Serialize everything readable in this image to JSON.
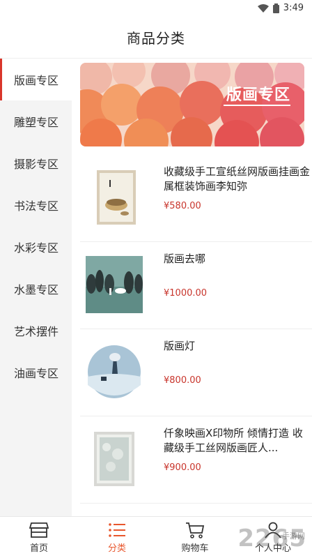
{
  "status_bar": {
    "time": "3:49"
  },
  "header": {
    "title": "商品分类"
  },
  "sidebar": {
    "items": [
      {
        "label": "版画专区"
      },
      {
        "label": "雕塑专区"
      },
      {
        "label": "摄影专区"
      },
      {
        "label": "书法专区"
      },
      {
        "label": "水彩专区"
      },
      {
        "label": "水墨专区"
      },
      {
        "label": "艺术摆件"
      },
      {
        "label": "油画专区"
      }
    ],
    "active_index": 0,
    "accent_color": "#d9362b"
  },
  "banner": {
    "title": "版画专区"
  },
  "products": [
    {
      "name": "收藏级手工宣纸丝网版画挂画金属框装饰画李知弥",
      "price": "¥580.00"
    },
    {
      "name": "版画去哪",
      "price": "¥1000.00"
    },
    {
      "name": "版画灯",
      "price": "¥800.00"
    },
    {
      "name": "仟象映画X印物所 倾情打造 收藏级手工丝网版画匠人...",
      "price": "¥900.00"
    }
  ],
  "tabbar": {
    "items": [
      {
        "label": "首页",
        "icon": "shop-icon"
      },
      {
        "label": "分类",
        "icon": "list-icon"
      },
      {
        "label": "购物车",
        "icon": "cart-icon"
      },
      {
        "label": "个人中心",
        "icon": "person-icon"
      }
    ],
    "active_color": "#e8572d"
  },
  "watermark": {
    "text": "2265",
    "sub": "手游网"
  }
}
